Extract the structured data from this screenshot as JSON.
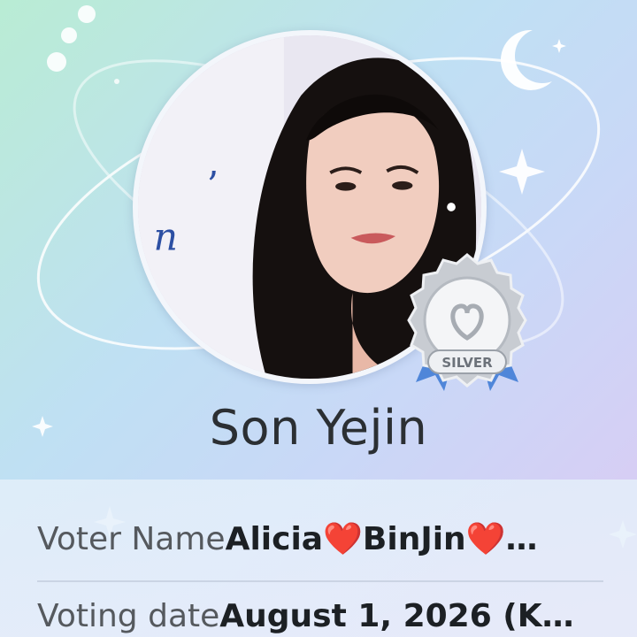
{
  "profile": {
    "name": "Son Yejin",
    "badge_text": "SILVER",
    "badge_level": "silver"
  },
  "details": {
    "voter_label": "Voter Name",
    "voter_value": "Alicia❤️BinJin❤️…",
    "date_label": "Voting date",
    "date_value": "August 1, 2026 (K…"
  },
  "colors": {
    "background_start": "#b9ecd4",
    "background_end": "#ddc9f3",
    "badge_silver": "#c8ccd2",
    "ribbon_blue": "#4f86d9"
  }
}
